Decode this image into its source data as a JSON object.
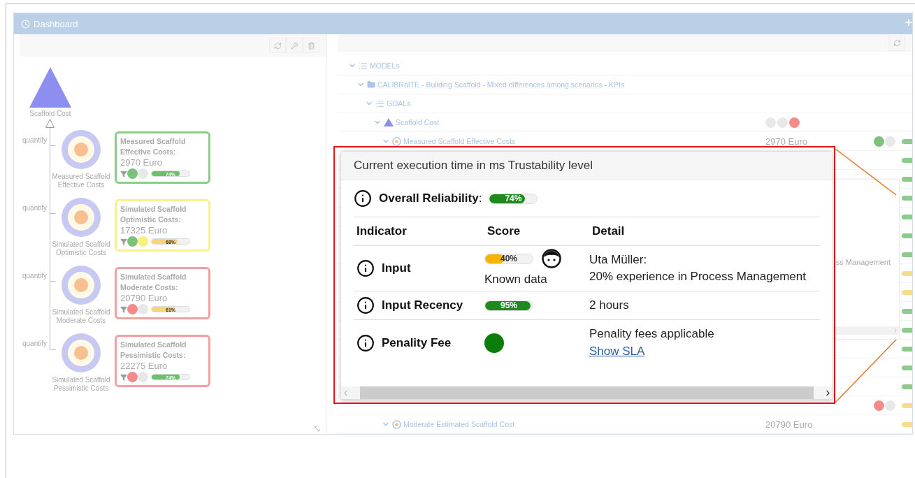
{
  "window": {
    "title": "Dashboard"
  },
  "left_panel": {
    "root": {
      "label": "Scaffold Cost"
    },
    "items": [
      {
        "relation": "quantify",
        "caption": "Measured Scaffold Effective Costs",
        "card": {
          "title": "Measured Scaffold Effective Costs:",
          "value": "2970 Euro",
          "color": "#8ccb8c",
          "dots": [
            {
              "color": "#7cc27c"
            },
            {
              "color": "#e8e8e8"
            }
          ],
          "bar": {
            "level": 0.74,
            "label": "74%",
            "color": "#6cbf6c"
          }
        }
      },
      {
        "relation": "quantify",
        "caption": "Simulated Scaffold Optimistic Costs",
        "card": {
          "title": "Simulated Scaffold Optimistic Costs:",
          "value": "17325 Euro",
          "color": "#f7f28a",
          "dots": [
            {
              "color": "#7cc27c"
            },
            {
              "color": "#f6f27a"
            }
          ],
          "bar": {
            "level": 0.68,
            "label": "68%",
            "color": "#f5d77a"
          }
        }
      },
      {
        "relation": "quantify",
        "caption": "Simulated Scaffold Moderate Costs",
        "card": {
          "title": "Simulated Scaffold Moderate Costs:",
          "value": "20790 Euro",
          "color": "#f4a0a0",
          "dots": [
            {
              "color": "#f58a8a"
            },
            {
              "color": "#e8e8e8"
            }
          ],
          "bar": {
            "level": 0.61,
            "label": "61%",
            "color": "#f5d77a"
          }
        }
      },
      {
        "relation": "quantify",
        "caption": "Simulated Scaffold Pessimistic Costs",
        "card": {
          "title": "Simulated Scaffold Pessimistic Costs:",
          "value": "22275 Euro",
          "color": "#f4a0a0",
          "dots": [
            {
              "color": "#f58a8a"
            },
            {
              "color": "#e8e8e8"
            }
          ],
          "bar": {
            "level": 0.74,
            "label": "74%",
            "color": "#6cbf6c"
          }
        }
      }
    ]
  },
  "tree": [
    {
      "kind": "list",
      "label": "MODELs",
      "expanded": true,
      "children": [
        {
          "kind": "folder",
          "label": "CALIBRaITE - Building Scaffold - Mixed differences among scenarios - KPIs",
          "expanded": true,
          "children": [
            {
              "kind": "list",
              "label": "GOALs",
              "expanded": true,
              "children": [
                {
                  "kind": "goal",
                  "label": "Scaffold Cost",
                  "expanded": true,
                  "dots": [
                    {
                      "color": "#e8e8e8"
                    },
                    {
                      "color": "#e8e8e8"
                    },
                    {
                      "color": "#f58a8a"
                    }
                  ],
                  "children": [
                    {
                      "kind": "indicator",
                      "label": "Measured Scaffold Effective Costs",
                      "expanded": true,
                      "value": "2970 Euro",
                      "dots": [
                        {
                          "color": "#7cc27c"
                        },
                        {
                          "color": "#e8e8e8"
                        }
                      ],
                      "bar": {
                        "color": "#8ccb8c"
                      }
                    },
                    {
                      "kind": "covered",
                      "bar": {
                        "color": "#8ccb8c"
                      }
                    },
                    {
                      "kind": "covered",
                      "bar": {
                        "color": "#8ccb8c"
                      }
                    },
                    {
                      "kind": "covered",
                      "bar": {
                        "color": "#8ccb8c"
                      }
                    },
                    {
                      "kind": "covered",
                      "bar": {
                        "color": "#8ccb8c"
                      }
                    },
                    {
                      "kind": "covered",
                      "bar": {
                        "color": "#8ccb8c"
                      }
                    },
                    {
                      "kind": "covered",
                      "bar": {
                        "color": "#8ccb8c"
                      }
                    },
                    {
                      "kind": "covered",
                      "bar": {
                        "color": "#f7dc8a"
                      }
                    },
                    {
                      "kind": "covered",
                      "bar": {
                        "color": "#f7dc8a"
                      }
                    },
                    {
                      "kind": "covered",
                      "bar": {
                        "color": "#8ccb8c"
                      }
                    },
                    {
                      "kind": "covered",
                      "bar": {
                        "color": "#8ccb8c"
                      }
                    },
                    {
                      "kind": "covered",
                      "bar": {
                        "color": "#8ccb8c"
                      }
                    },
                    {
                      "kind": "covered",
                      "bar": {
                        "color": "#8ccb8c"
                      }
                    },
                    {
                      "kind": "covered",
                      "bar": {
                        "color": "#8ccb8c"
                      }
                    },
                    {
                      "kind": "covered",
                      "dots": [
                        {
                          "color": "#f58a8a"
                        },
                        {
                          "color": "#e8e8e8"
                        }
                      ],
                      "bar": {
                        "color": "#f7dc8a"
                      }
                    },
                    {
                      "kind": "indicator",
                      "label": "Moderate Estimated Scaffold Cost",
                      "expanded": true,
                      "value": "20790 Euro",
                      "bar": {
                        "color": "#f7dc8a"
                      }
                    }
                  ]
                }
              ]
            }
          ]
        }
      ]
    }
  ],
  "ghost_popup": {
    "text": "ss Management"
  },
  "popup": {
    "title": "Current execution time in ms Trustability level",
    "overall": {
      "label": "**Overall Reliability**:",
      "level": 0.74,
      "bar_label": "74%",
      "color": "#1e8a1e"
    },
    "columns": [
      "Indicator",
      "Score",
      "Detail"
    ],
    "rows": [
      {
        "kind": "person_bar",
        "label": "Input",
        "score": {
          "level": 0.4,
          "label": "40%",
          "color": "#f5b400"
        },
        "note": "Known data",
        "detail": [
          "Uta Müller:",
          "20% experience in Process Management"
        ]
      },
      {
        "kind": "bar",
        "label": "Input Recency",
        "score": {
          "level": 0.95,
          "label": "95%",
          "color": "#1e8a1e"
        },
        "detail": [
          "2 hours"
        ]
      },
      {
        "kind": "dot",
        "label": "Penality Fee",
        "score": {
          "color": "#0a7d0a"
        },
        "detail": [
          "Penality fees applicable"
        ],
        "link": "Show SLA"
      }
    ]
  }
}
